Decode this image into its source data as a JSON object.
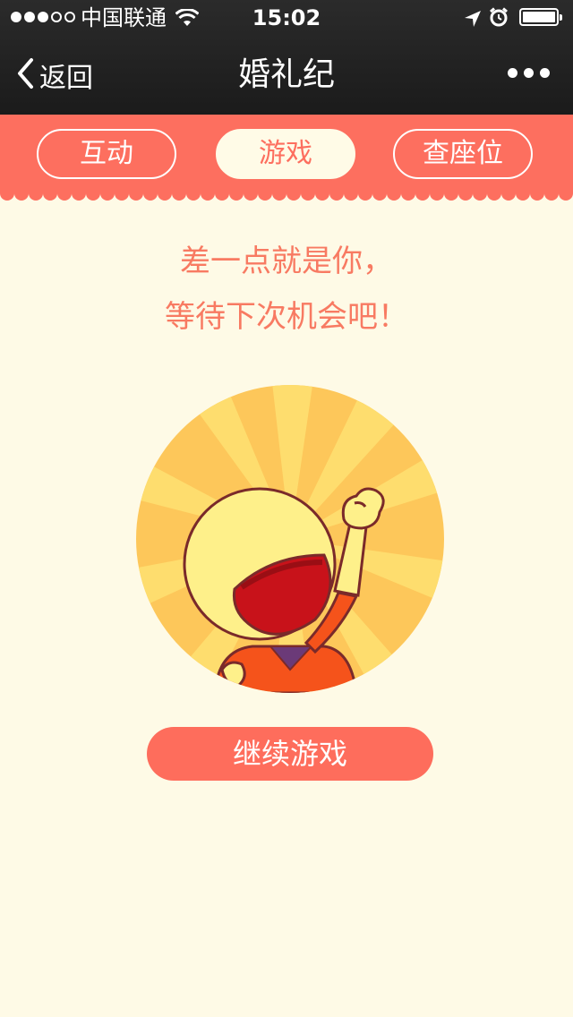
{
  "status_bar": {
    "carrier": "中国联通",
    "time": "15:02",
    "signal_strength": "3 of 5",
    "battery_level": 1.0
  },
  "nav": {
    "back_label": "返回",
    "title": "婚礼纪",
    "more_icon": "more-dots-icon"
  },
  "tabs": [
    {
      "label": "互动",
      "active": false
    },
    {
      "label": "游戏",
      "active": true
    },
    {
      "label": "查座位",
      "active": false
    }
  ],
  "message": {
    "line1": "差一点就是你，",
    "line2": "等待下次机会吧！"
  },
  "illustration": {
    "icon": "cheering-cartoon-character"
  },
  "continue_button_label": "继续游戏",
  "colors": {
    "accent": "#fd6f5f",
    "background": "#fefae6",
    "message_text": "#f87a62",
    "nav_bar": "#1e1e1e"
  }
}
